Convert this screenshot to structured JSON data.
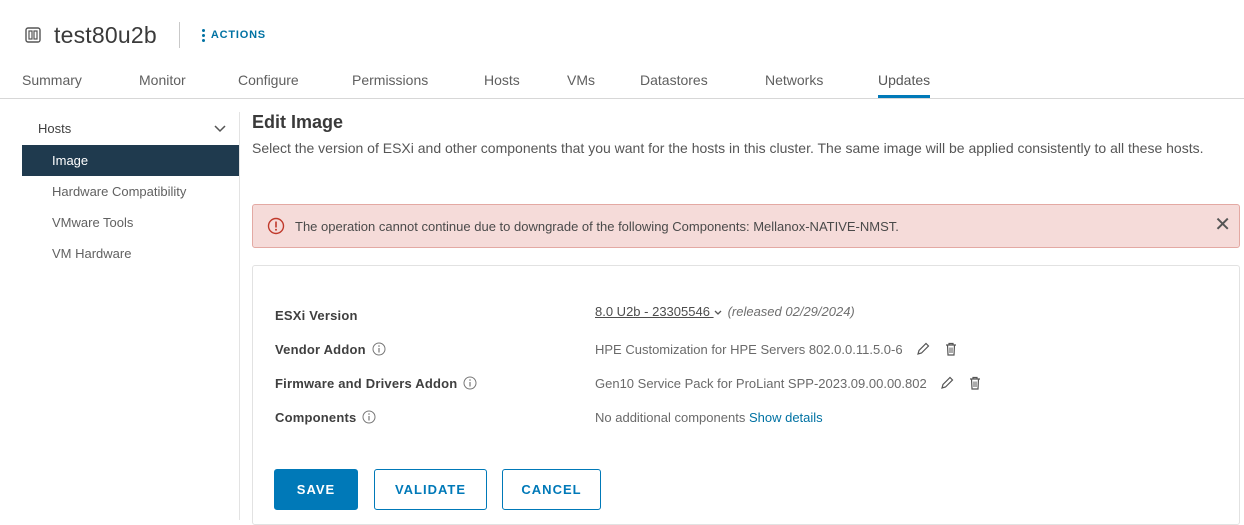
{
  "header": {
    "title": "test80u2b",
    "actions_label": "ACTIONS"
  },
  "tabs": [
    {
      "label": "Summary"
    },
    {
      "label": "Monitor"
    },
    {
      "label": "Configure"
    },
    {
      "label": "Permissions"
    },
    {
      "label": "Hosts"
    },
    {
      "label": "VMs"
    },
    {
      "label": "Datastores"
    },
    {
      "label": "Networks"
    },
    {
      "label": "Updates"
    }
  ],
  "active_tab": "Updates",
  "sidebar": {
    "section": "Hosts",
    "items": [
      {
        "label": "Image"
      },
      {
        "label": "Hardware Compatibility"
      },
      {
        "label": "VMware Tools"
      },
      {
        "label": "VM Hardware"
      }
    ]
  },
  "main": {
    "heading": "Edit Image",
    "description": "Select the version of ESXi and other components that you want for the hosts in this cluster. The same image will be applied consistently to all these hosts."
  },
  "alert": {
    "message": "The operation cannot continue due to downgrade of the following Components: Mellanox-NATIVE-NMST.",
    "close_glyph": "✕"
  },
  "image": {
    "esxi_label": "ESXi Version",
    "esxi_version": "8.0 U2b - 23305546",
    "esxi_released": "(released 02/29/2024)",
    "vendor_label": "Vendor Addon",
    "vendor_value": "HPE Customization for HPE Servers 802.0.0.11.5.0-6",
    "firmware_label": "Firmware and Drivers Addon",
    "firmware_value": "Gen10 Service Pack for ProLiant SPP-2023.09.00.00.802",
    "components_label": "Components",
    "components_value": "No additional components",
    "show_details": "Show details"
  },
  "buttons": {
    "save": "SAVE",
    "validate": "VALIDATE",
    "cancel": "CANCEL"
  },
  "colors": {
    "accent": "#0079b8",
    "sidebar_active": "#1f3a4e",
    "alert_bg": "#f5dbd9",
    "alert_border": "#e3a9a3"
  }
}
